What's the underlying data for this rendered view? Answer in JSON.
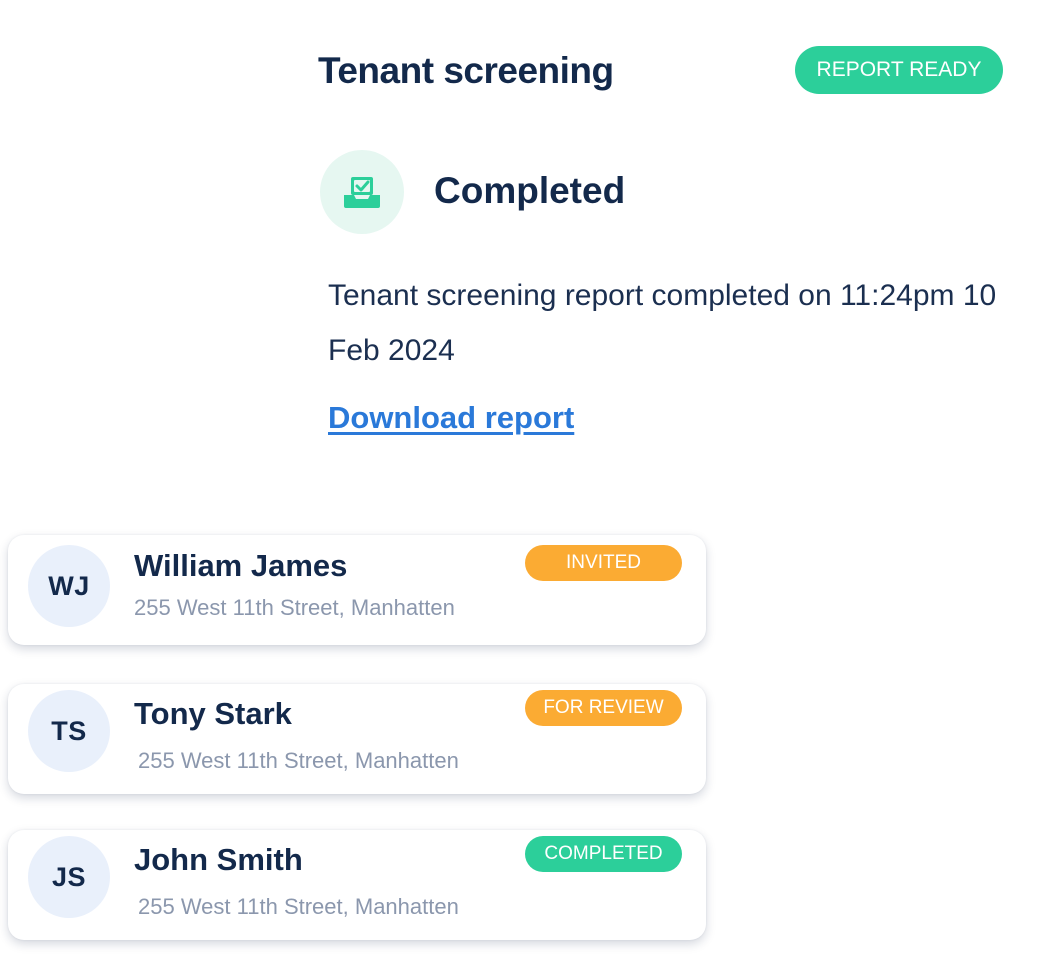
{
  "screening": {
    "title": "Tenant screening",
    "badge": {
      "label": "REPORT READY",
      "color": "#2ccf9a"
    },
    "status": {
      "icon": "inbox-check-icon",
      "title": "Completed",
      "description": "Tenant screening report completed on 11:24pm 10 Feb 2024"
    },
    "download_label": "Download report"
  },
  "tenants": [
    {
      "initials": "WJ",
      "name": "William James",
      "address": "255 West 11th Street, Manhatten",
      "status": "INVITED",
      "status_color": "#fbab33"
    },
    {
      "initials": "TS",
      "name": "Tony Stark",
      "address": "255 West 11th Street, Manhatten",
      "status": "FOR REVIEW",
      "status_color": "#fbab33"
    },
    {
      "initials": "JS",
      "name": "John Smith",
      "address": "255 West 11th Street, Manhatten",
      "status": "COMPLETED",
      "status_color": "#2ccf9a"
    }
  ],
  "colors": {
    "heading": "#13294b",
    "link": "#2a79d9",
    "muted_text": "#8b97ad",
    "avatar_bg": "#e9f0fb",
    "icon_bg": "#e6f7f1"
  }
}
